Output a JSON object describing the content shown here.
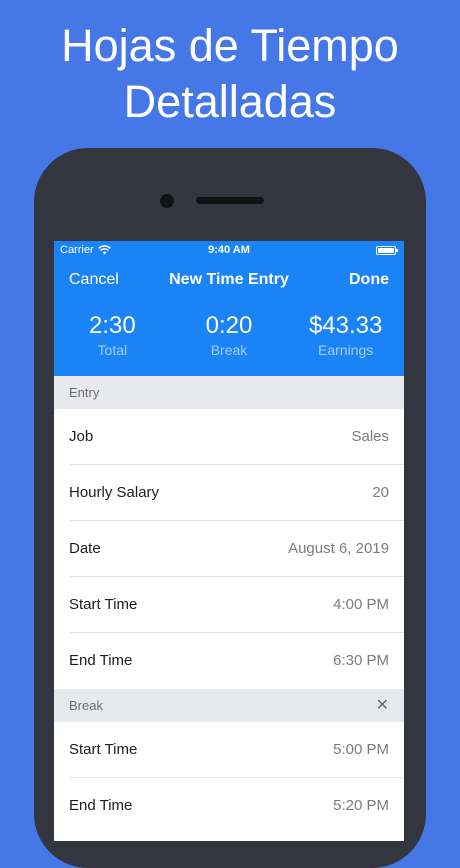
{
  "headline": {
    "line1": "Hojas de Tiempo",
    "line2": "Detalladas"
  },
  "status_bar": {
    "carrier": "Carrier",
    "time": "9:40 AM"
  },
  "nav": {
    "cancel": "Cancel",
    "title": "New Time Entry",
    "done": "Done"
  },
  "stats": [
    {
      "value": "2:30",
      "label": "Total"
    },
    {
      "value": "0:20",
      "label": "Break"
    },
    {
      "value": "$43.33",
      "label": "Earnings"
    }
  ],
  "entry_section": {
    "header": "Entry",
    "rows": [
      {
        "label": "Job",
        "value": "Sales"
      },
      {
        "label": "Hourly Salary",
        "value": "20"
      },
      {
        "label": "Date",
        "value": "August 6, 2019"
      },
      {
        "label": "Start Time",
        "value": "4:00 PM"
      },
      {
        "label": "End Time",
        "value": "6:30 PM"
      }
    ]
  },
  "break_section": {
    "header": "Break",
    "close_icon": "close-icon",
    "rows": [
      {
        "label": "Start Time",
        "value": "5:00 PM"
      },
      {
        "label": "End Time",
        "value": "5:20 PM"
      }
    ]
  },
  "colors": {
    "background": "#4578e6",
    "nav_blue": "#1a83f6",
    "phone_body": "#33363f"
  }
}
